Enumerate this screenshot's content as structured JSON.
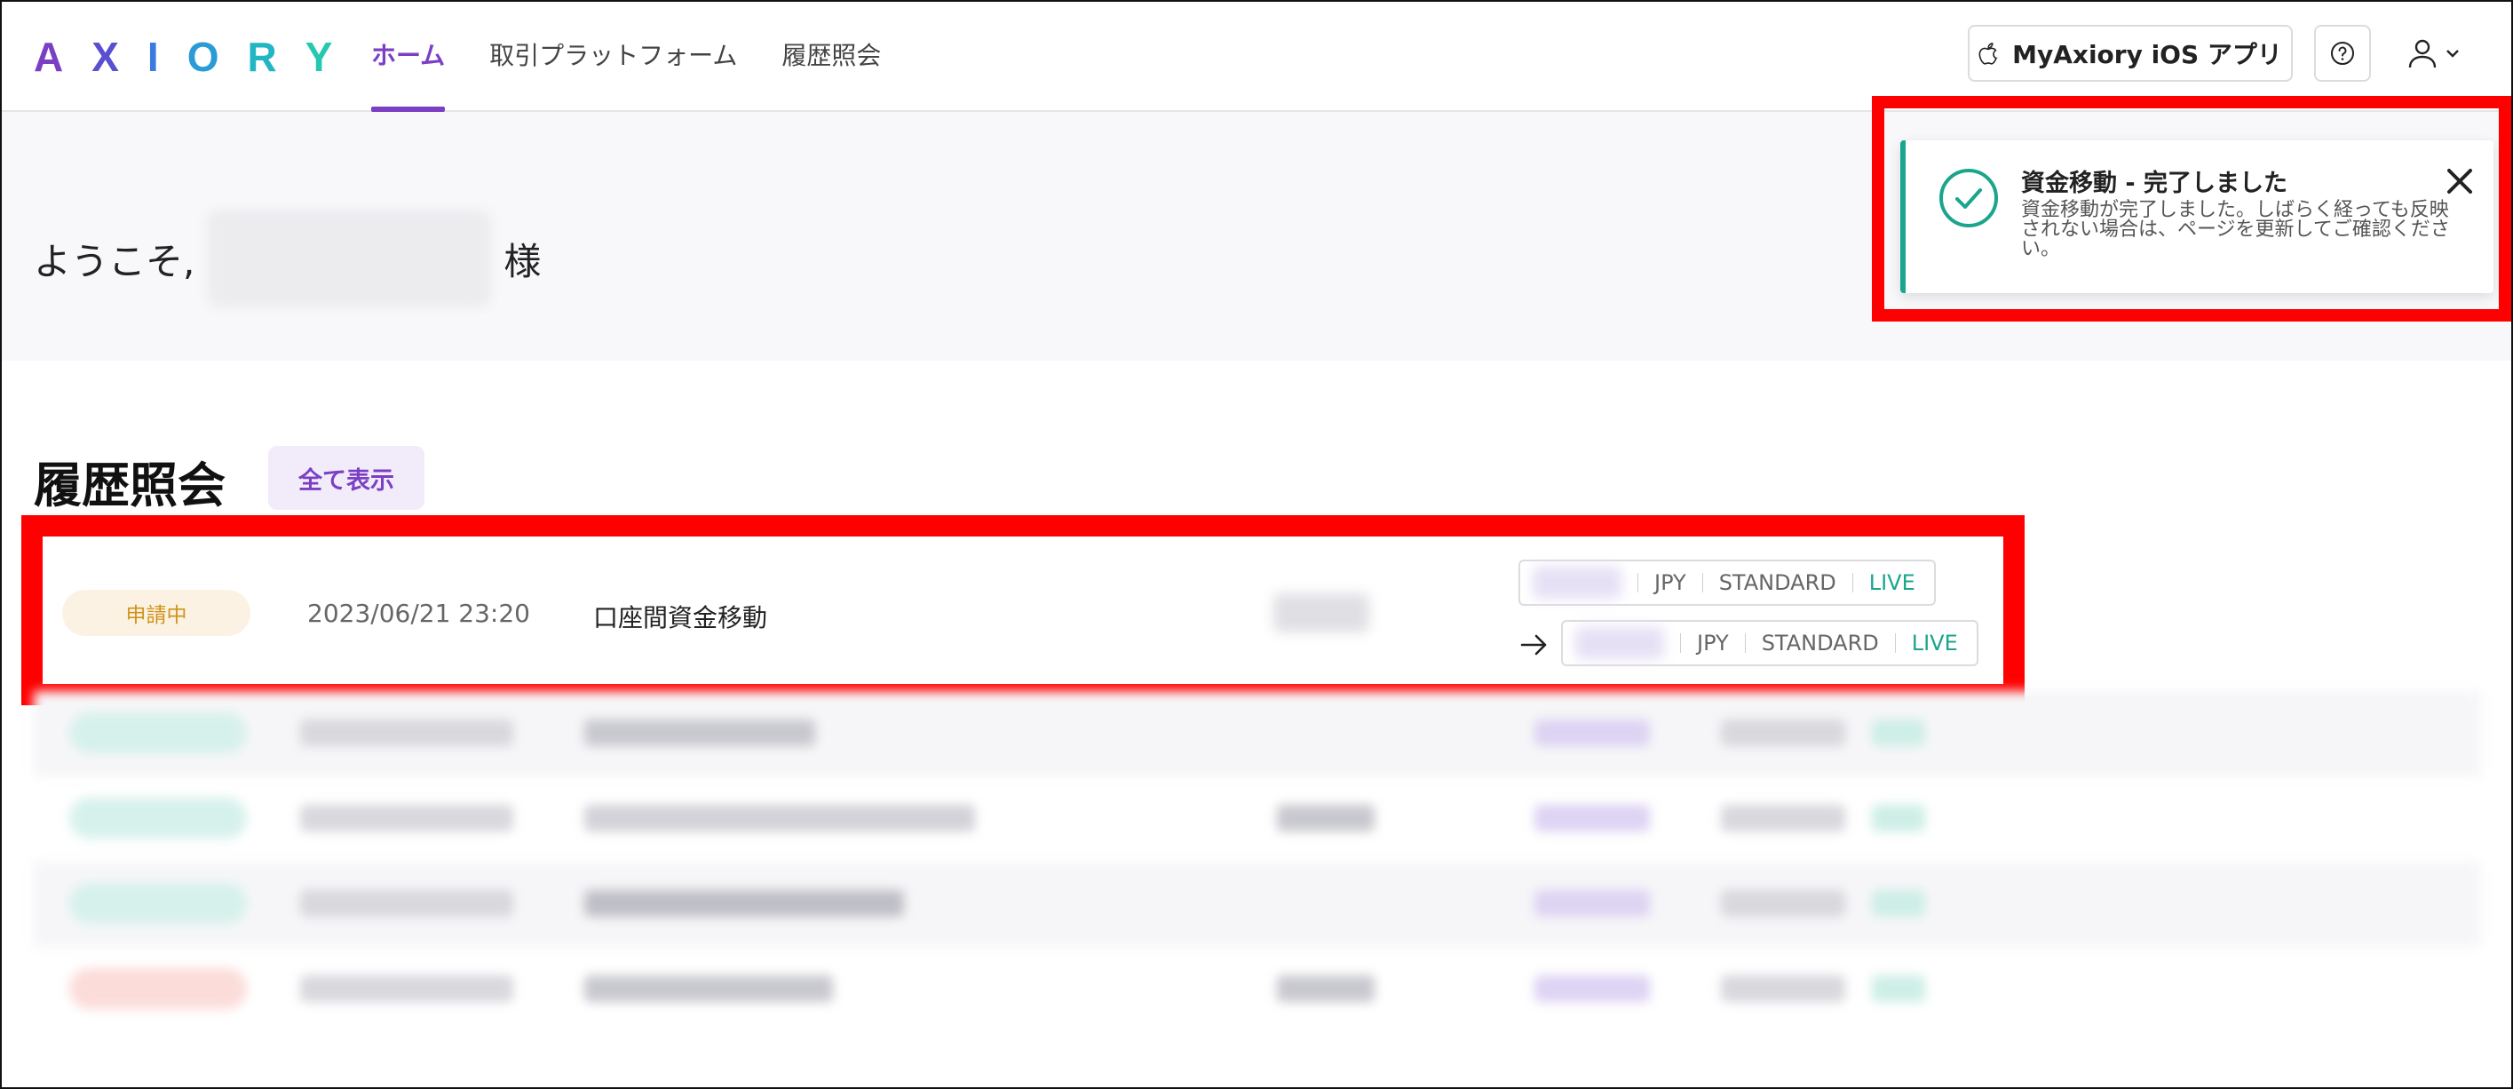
{
  "header": {
    "logo_letters": [
      {
        "char": "A",
        "color": "#7b3fc4"
      },
      {
        "char": "X",
        "color": "#5a4fcf"
      },
      {
        "char": "I",
        "color": "#3b7be0"
      },
      {
        "char": "O",
        "color": "#2a9bd6"
      },
      {
        "char": "R",
        "color": "#22b6c4"
      },
      {
        "char": "Y",
        "color": "#27c8b1"
      }
    ],
    "nav": [
      {
        "label": "ホーム",
        "active": true
      },
      {
        "label": "取引プラットフォーム",
        "active": false
      },
      {
        "label": "履歴照会",
        "active": false
      }
    ],
    "app_button_label": "MyAxiory iOS アプリ",
    "icons": {
      "app": "apple-icon",
      "help": "question-circle-icon",
      "user": "user-icon",
      "chevron": "chevron-down-icon"
    }
  },
  "welcome": {
    "prefix": "ようこそ,",
    "suffix": "様"
  },
  "toast": {
    "title": "資金移動 - 完了しました",
    "message": "資金移動が完了しました。しばらく経っても反映されない場合は、ページを更新してご確認ください。",
    "accent_color": "#1aa58c",
    "icon": "check-circle-icon"
  },
  "history": {
    "title": "履歴照会",
    "show_all_label": "全て表示",
    "highlighted_row": {
      "status": "申請中",
      "date": "2023/06/21 23:20",
      "type": "口座間資金移動",
      "from_account": {
        "currency": "JPY",
        "type": "STANDARD",
        "env": "LIVE"
      },
      "to_account": {
        "currency": "JPY",
        "type": "STANDARD",
        "env": "LIVE"
      }
    }
  },
  "colors": {
    "brand_purple": "#7b3fc4",
    "live_green": "#1aa58c",
    "pending_orange": "#d0931b",
    "highlight_red": "#ff0000"
  }
}
